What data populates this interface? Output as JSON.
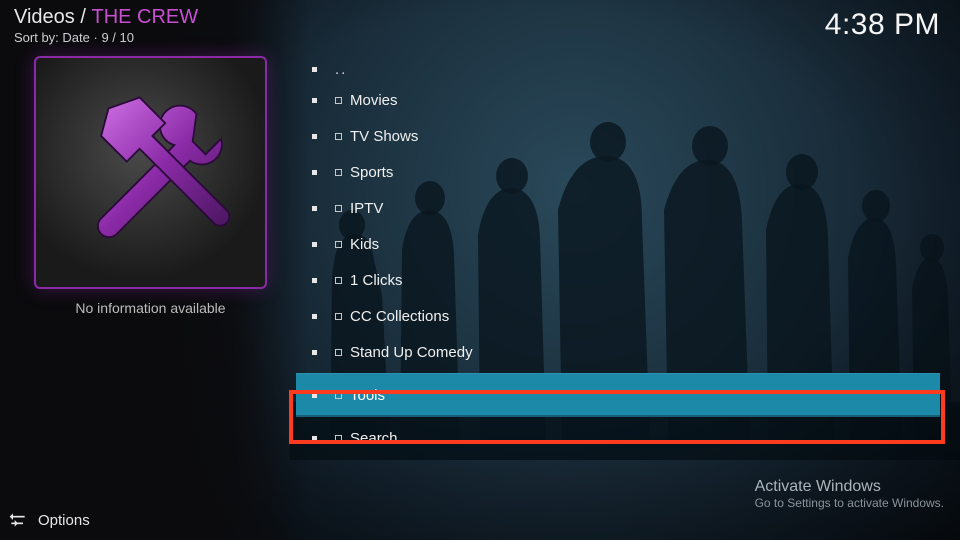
{
  "header": {
    "root": "Videos",
    "title": "THE CREW",
    "sort_label": "Sort by: Date",
    "position": "9 / 10",
    "time": "4:38 PM"
  },
  "sidebar": {
    "no_info": "No information available"
  },
  "list": {
    "selected_index": 9,
    "items": [
      {
        "label": ".."
      },
      {
        "label": "Movies"
      },
      {
        "label": "TV Shows"
      },
      {
        "label": "Sports"
      },
      {
        "label": "IPTV"
      },
      {
        "label": "Kids"
      },
      {
        "label": "1 Clicks"
      },
      {
        "label": "CC Collections"
      },
      {
        "label": "Stand Up Comedy"
      },
      {
        "label": "Tools"
      },
      {
        "label": "Search"
      }
    ]
  },
  "footer": {
    "options": "Options"
  },
  "watermark": {
    "title": "Activate Windows",
    "sub": "Go to Settings to activate Windows."
  },
  "colors": {
    "accent": "#c84fd2",
    "selection": "#1d89a8",
    "highlight_border": "#ff3b1f"
  }
}
